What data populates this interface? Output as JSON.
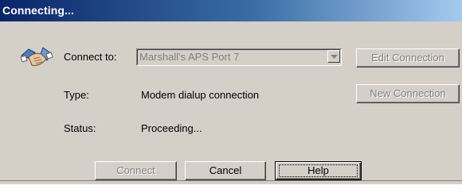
{
  "window": {
    "title": "Connecting..."
  },
  "labels": {
    "connect_to": "Connect to:",
    "type": "Type:",
    "status": "Status:"
  },
  "values": {
    "connection_name": "Marshall's APS Port 7",
    "type": "Modem dialup connection",
    "status": "Proceeding..."
  },
  "buttons": {
    "edit_connection": "Edit Connection",
    "new_connection": "New Connection",
    "connect": "Connect",
    "cancel": "Cancel",
    "help": "Help"
  },
  "states": {
    "connection_combo_enabled": false,
    "edit_connection_enabled": false,
    "new_connection_enabled": false,
    "connect_enabled": false,
    "focused_button": "Help"
  },
  "icons": {
    "connection": "handshake-icon",
    "dropdown": "chevron-down-icon"
  },
  "colors": {
    "title_bar_start": "#0a246a",
    "title_bar_end": "#a6caf0",
    "dialog_background": "#d4d0c8",
    "disabled_text": "#808080"
  }
}
